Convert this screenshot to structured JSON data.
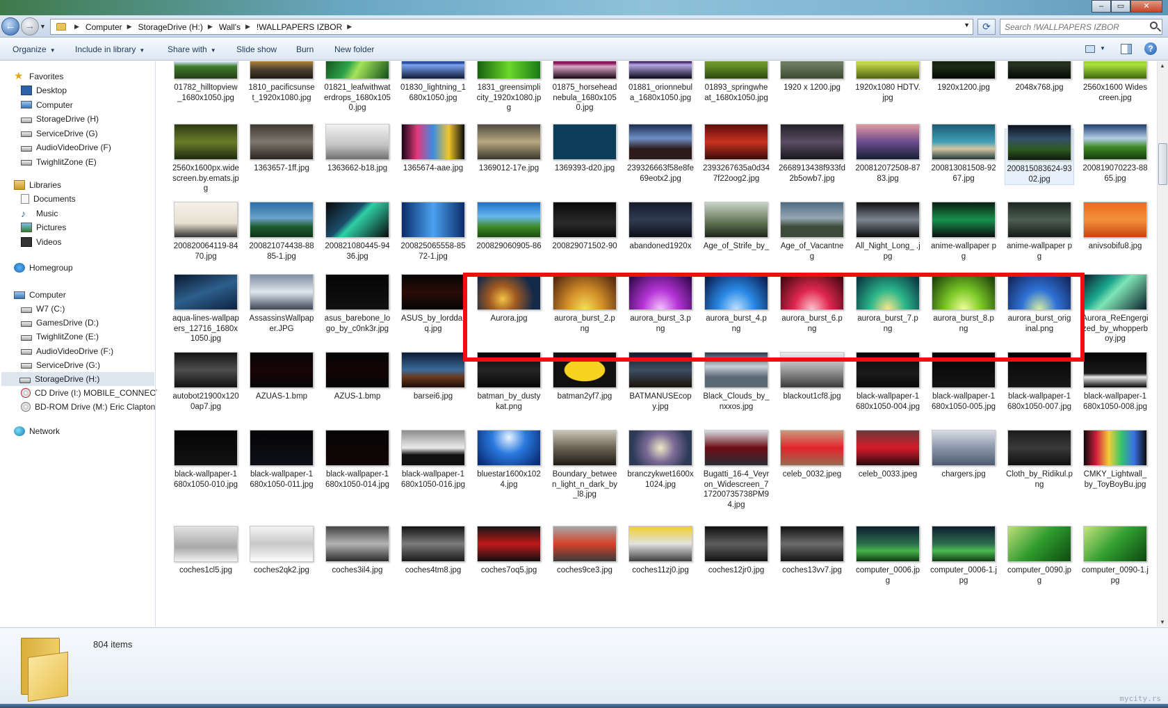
{
  "window": {
    "minimize_glyph": "–",
    "maximize_glyph": "▭",
    "close_glyph": "✕"
  },
  "navigation": {
    "back_glyph": "←",
    "forward_glyph": "→",
    "breadcrumb": [
      "Computer",
      "StorageDrive (H:)",
      "Wall's",
      "!WALLPAPERS IZBOR"
    ],
    "search_placeholder": "Search !WALLPAPERS IZBOR",
    "refresh_glyph": "⟳"
  },
  "toolbar": {
    "organize": "Organize",
    "include_in_library": "Include in library",
    "share_with": "Share with",
    "slide_show": "Slide show",
    "burn": "Burn",
    "new_folder": "New folder",
    "help_glyph": "?"
  },
  "sidebar": {
    "favorites": {
      "label": "Favorites",
      "items": [
        "Desktop",
        "Computer",
        "StorageDrive (H)",
        "ServiceDrive (G)",
        "AudioVideoDrive (F)",
        "TwighlitZone (E)"
      ]
    },
    "libraries": {
      "label": "Libraries",
      "items": [
        "Documents",
        "Music",
        "Pictures",
        "Videos"
      ]
    },
    "homegroup": "Homegroup",
    "computer": {
      "label": "Computer",
      "items": [
        "W7 (C:)",
        "GamesDrive (D:)",
        "TwighlitZone (E:)",
        "AudioVideoDrive (F:)",
        "ServiceDrive (G:)",
        "StorageDrive (H:)",
        "CD Drive (I:) MOBILE_CONNECT",
        "BD-ROM Drive (M:) Eric Clapton"
      ]
    },
    "network": "Network",
    "selected": "StorageDrive (H:)"
  },
  "files": [
    "01782_hilltopview_1680x1050.jpg",
    "1810_pacificsunset_1920x1080.jpg",
    "01821_leafwithwaterdrops_1680x1050.jpg",
    "01830_lightning_1680x1050.jpg",
    "1831_greensimplicity_1920x1080.jpg",
    "01875_horseheadnebula_1680x1050.jpg",
    "01881_orionnebula_1680x1050.jpg",
    "01893_springwheat_1680x1050.jpg",
    "1920 x 1200.jpg",
    "1920x1080 HDTV.jpg",
    "1920x1200.jpg",
    "2048x768.jpg",
    "2560x1600 Widescreen.jpg",
    "2560x1600px.widescreen.by.emats.jpg",
    "1363657-1ff.jpg",
    "1363662-b18.jpg",
    "1365674-aae.jpg",
    "1369012-17e.jpg",
    "1369393-d20.jpg",
    "239326663f58e8fe69eotx2.jpg",
    "2393267635a0d347f22oog2.jpg",
    "2668913438f933fd2b5owb7.jpg",
    "200812072508-8783.jpg",
    "200813081508-9267.jpg",
    "200815083624-9302.jpg",
    "200819070223-8865.jpg",
    "200820064119-8470.jpg",
    "200821074438-8885-1.jpg",
    "200821080445-9436.jpg",
    "200825065558-8572-1.jpg",
    "200829060905-86",
    "200829071502-90",
    "abandoned1920x",
    "Age_of_Strife_by_",
    "Age_of_Vacantne g",
    "All_Night_Long_ .jpg",
    "anime-wallpaper pg",
    "anime-wallpaper pg",
    "anivsobifu8.jpg",
    "aqua-lines-wallpapers_12716_1680x1050.jpg",
    "AssassinsWallpaper.JPG",
    "asus_barebone_logo_by_c0nk3r.jpg",
    "ASUS_by_lorddar q.jpg",
    "Aurora.jpg",
    "aurora_burst_2.p ng",
    "aurora_burst_3.p ng",
    "aurora_burst_4.p ng",
    "aurora_burst_6.p ng",
    "aurora_burst_7.p ng",
    "aurora_burst_8.p ng",
    "aurora_burst_orig inal.png",
    "Aurora_ReEngergized_by_whopperboy.jpg",
    "autobot21900x1200ap7.jpg",
    "AZUAS-1.bmp",
    "AZUS-1.bmp",
    "barsei6.jpg",
    "batman_by_dustykat.png",
    "batman2yf7.jpg",
    "BATMANUSEcopy.jpg",
    "Black_Clouds_by_nxxos.jpg",
    "blackout1cf8.jpg",
    "black-wallpaper-1680x1050-004.jpg",
    "black-wallpaper-1680x1050-005.jpg",
    "black-wallpaper-1680x1050-007.jpg",
    "black-wallpaper-1680x1050-008.jpg",
    "black-wallpaper-1680x1050-010.jpg",
    "black-wallpaper-1680x1050-011.jpg",
    "black-wallpaper-1680x1050-014.jpg",
    "black-wallpaper-1680x1050-016.jpg",
    "bluestar1600x1024.jpg",
    "Boundary_between_light_n_dark_by_l8.jpg",
    "branczykwet1600x1024.jpg",
    "Bugatti_16-4_Veyron_Widescreen_717200735738PM94.jpg",
    "celeb_0032.jpeg",
    "celeb_0033.jpeg",
    "chargers.jpg",
    "Cloth_by_Ridikul.png",
    "CMKY_Lightwall_by_ToyBoyBu.jpg",
    "coches1cl5.jpg",
    "coches2qk2.jpg",
    "coches3il4.jpg",
    "coches4tm8.jpg",
    "coches7oq5.jpg",
    "coches9ce3.jpg",
    "coches11zj0.jpg",
    "coches12jr0.jpg",
    "coches13vv7.jpg",
    "computer_0006.jpg",
    "computer_0006-1.jpg",
    "computer_0090.jpg",
    "computer_0090-1.jpg"
  ],
  "selected_file": "200815083624-9302.jpg",
  "status": {
    "item_count": "804 items"
  },
  "watermark": "mycity.rs",
  "colors": {
    "highlight_box": "#ee0f0f",
    "selection": "#dde5ee"
  }
}
